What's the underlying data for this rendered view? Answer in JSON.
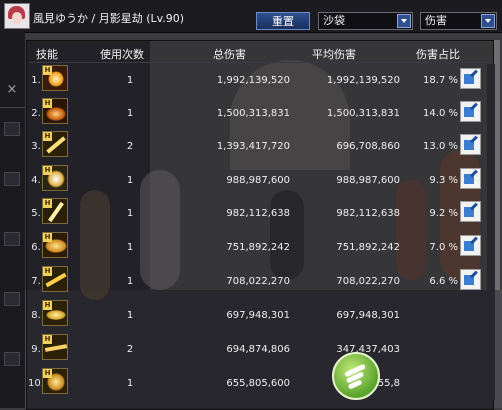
{
  "header": {
    "character": "風見ゆうか / 月影星劫 (Lv.90)",
    "reset_button": "重置",
    "target_select": "沙袋",
    "metric_select": "伤害"
  },
  "table": {
    "columns": [
      "技能",
      "使用次数",
      "总伤害",
      "平均伤害",
      "伤害占比"
    ],
    "rows": [
      {
        "rank": "1.",
        "uses": "1",
        "total": "1,992,139,520",
        "avg": "1,992,139,520",
        "pct": "18.7 %"
      },
      {
        "rank": "2.",
        "uses": "1",
        "total": "1,500,313,831",
        "avg": "1,500,313,831",
        "pct": "14.0 %"
      },
      {
        "rank": "3.",
        "uses": "2",
        "total": "1,393,417,720",
        "avg": "696,708,860",
        "pct": "13.0 %"
      },
      {
        "rank": "4.",
        "uses": "1",
        "total": "988,987,600",
        "avg": "988,987,600",
        "pct": "9.3 %"
      },
      {
        "rank": "5.",
        "uses": "1",
        "total": "982,112,638",
        "avg": "982,112,638",
        "pct": "9.2 %"
      },
      {
        "rank": "6.",
        "uses": "1",
        "total": "751,892,242",
        "avg": "751,892,242",
        "pct": "7.0 %"
      },
      {
        "rank": "7.",
        "uses": "1",
        "total": "708,022,270",
        "avg": "708,022,270",
        "pct": "6.6 %"
      },
      {
        "rank": "8.",
        "uses": "1",
        "total": "697,948,301",
        "avg": "697,948,301",
        "pct": ""
      },
      {
        "rank": "9.",
        "uses": "2",
        "total": "694,874,806",
        "avg": "347,437,403",
        "pct": ""
      },
      {
        "rank": "10.",
        "uses": "1",
        "total": "655,805,600",
        "avg": "655,8",
        "pct": ""
      }
    ]
  },
  "skill_badge": "H",
  "icons": {
    "close": "×",
    "share": "share-icon",
    "dropdown": "chevron-down-icon"
  },
  "colors": {
    "accent": "#2f4f8e",
    "panel": "#121218",
    "share_blue": "#3c7dd0"
  }
}
